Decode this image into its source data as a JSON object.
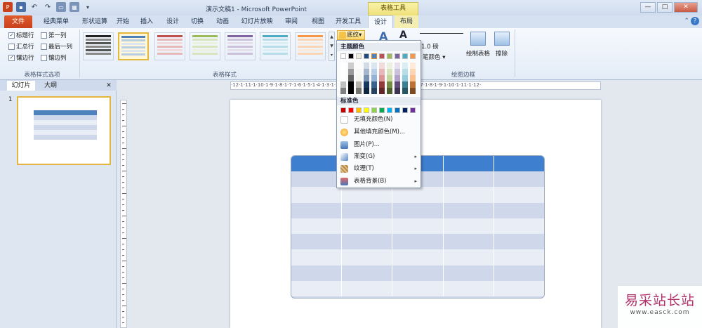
{
  "window": {
    "title": "演示文稿1 - Microsoft PowerPoint",
    "context_tab_header": "表格工具",
    "min": "—",
    "max": "□",
    "close": "✕"
  },
  "tabs": {
    "file": "文件",
    "classic": "经典菜单",
    "shape": "形状运算",
    "home": "开始",
    "insert": "插入",
    "design": "设计",
    "transitions": "切换",
    "animations": "动画",
    "slideshow": "幻灯片放映",
    "review": "审阅",
    "view": "视图",
    "developer": "开发工具",
    "table_design": "设计",
    "layout": "布局"
  },
  "options": {
    "header_row": "标题行",
    "total_row": "汇总行",
    "banded_rows": "镶边行",
    "first_col": "第一列",
    "last_col": "最后一列",
    "banded_cols": "镶边列",
    "header_row_checked": "✓",
    "banded_rows_checked": "✓",
    "group_label": "表格样式选项"
  },
  "styles": {
    "group_label": "表格样式"
  },
  "shading": {
    "button": "底纹",
    "pen_weight": "1.0 磅",
    "pen_color": "笔颜色",
    "draw_table": "绘制表格",
    "eraser": "擦除",
    "group_label": "绘图边框"
  },
  "dropdown": {
    "theme_colors": "主题颜色",
    "standard_colors": "标准色",
    "no_fill": "无填充颜色(N)",
    "more_colors": "其他填充颜色(M)...",
    "picture": "图片(P)...",
    "gradient": "渐变(G)",
    "texture": "纹理(T)",
    "background": "表格背景(B)",
    "theme_row": [
      "#ffffff",
      "#000000",
      "#eeece1",
      "#1f497d",
      "#4f81bd",
      "#c0504d",
      "#9bbb59",
      "#8064a2",
      "#4bacc6",
      "#f79646"
    ],
    "standard_row": [
      "#c00000",
      "#ff0000",
      "#ffc000",
      "#ffff00",
      "#92d050",
      "#00b050",
      "#00b0f0",
      "#0070c0",
      "#002060",
      "#7030a0"
    ]
  },
  "panel": {
    "tab_slides": "幻灯片",
    "tab_outline": "大纲",
    "close": "✕",
    "slide_number": "1"
  },
  "ruler": {
    "h_text": "·12·1·11·1·10·1·9·1·8·1·7·1·6·1·5·1·4·1·3·1·2·1·1·1·0·1·1·1·2·1·3·1·4·1·5·1·6·1·7·1·8·1·9·1·10·1·11·1·12·"
  },
  "watermark": {
    "title": "易采站长站",
    "url": "www.easck.com"
  },
  "colors": {
    "accent": "#4a86cf",
    "header_blue": "#3f7fcf",
    "band_dark": "#cfd8ea",
    "band_light": "#e9edf5"
  }
}
